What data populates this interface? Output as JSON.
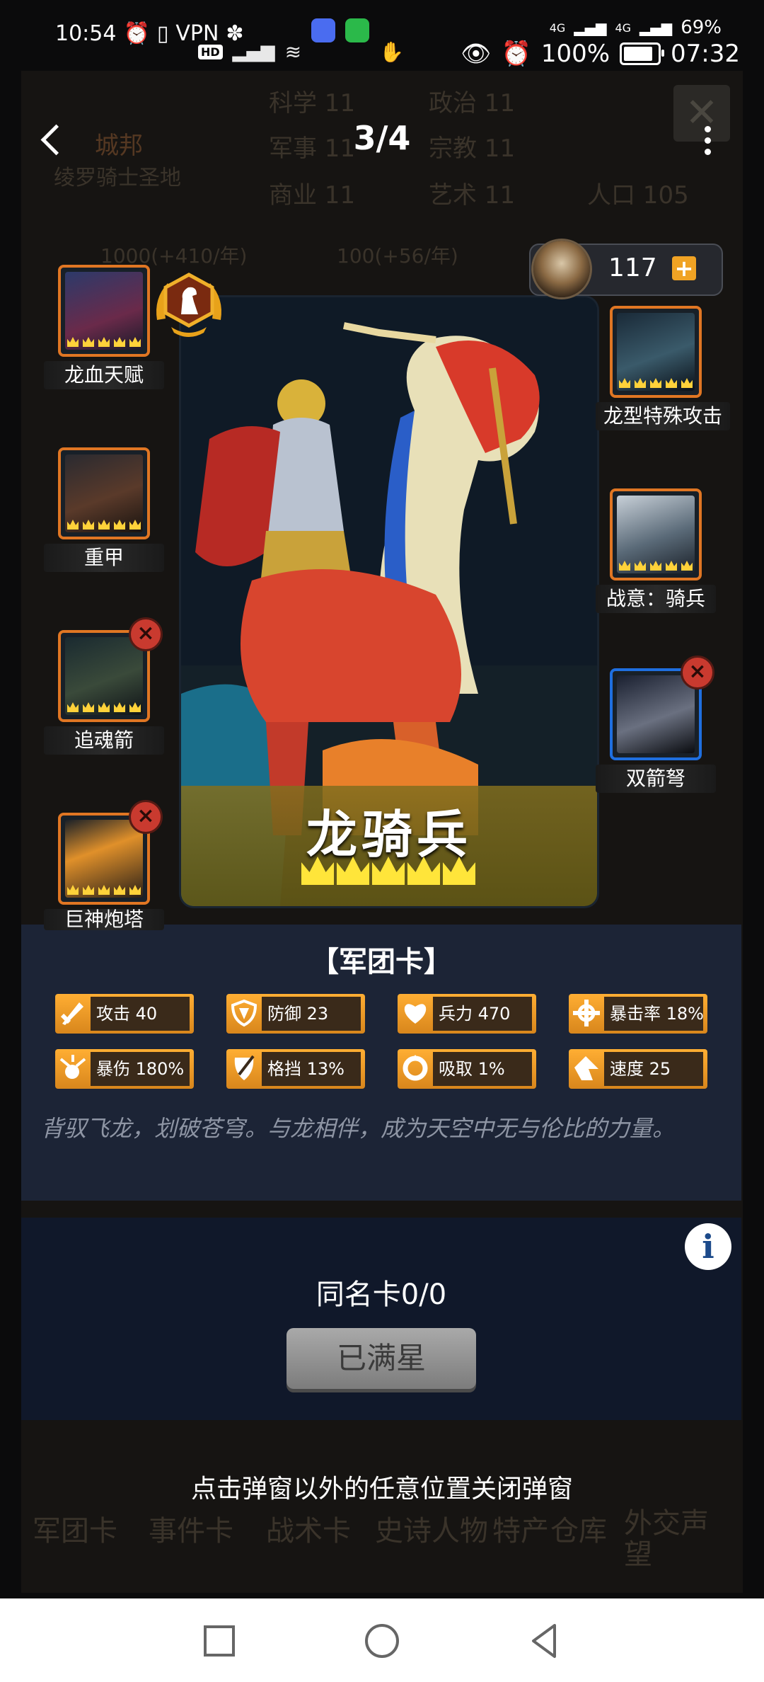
{
  "status_bar": {
    "time_left": "10:54",
    "vpn": "VPN",
    "hd": "HD",
    "net_4g_1": "4G",
    "net_4g_2": "4G",
    "battery_pct_1": "69%",
    "battery_pct_2": "100%",
    "time_right": "07:32"
  },
  "background": {
    "city_badge": "城邦",
    "city_name": "绫罗骑士圣地",
    "stats": [
      "科学 11",
      "政治 11",
      "军事 11",
      "宗教 11",
      "商业 11",
      "艺术 11",
      "人口 105"
    ],
    "resource_1": "1000(+410/年)",
    "resource_2": "100(+56/年)",
    "tabs": [
      "军团卡",
      "事件卡",
      "战术卡",
      "史诗人物",
      "特产",
      "仓库",
      "外交声望"
    ]
  },
  "header": {
    "page_counter": "3/4"
  },
  "currency": {
    "value": "117",
    "plus": "+"
  },
  "skills_left": [
    {
      "label": "龙血天赋",
      "removable": false
    },
    {
      "label": "重甲",
      "removable": false
    },
    {
      "label": "追魂箭",
      "removable": true
    },
    {
      "label": "巨神炮塔",
      "removable": true
    }
  ],
  "skills_right": [
    {
      "label": "龙型特殊攻击",
      "removable": false
    },
    {
      "label": "战意：骑兵",
      "removable": false
    },
    {
      "label": "双箭弩",
      "removable": true
    }
  ],
  "card": {
    "name": "龙骑兵",
    "stars": 5,
    "type": "【军团卡】"
  },
  "stats": [
    {
      "icon": "sword-icon",
      "label": "攻击 40"
    },
    {
      "icon": "shield-icon",
      "label": "防御 23"
    },
    {
      "icon": "heart-icon",
      "label": "兵力 470"
    },
    {
      "icon": "crit-rate-icon",
      "label": "暴击率 18%"
    },
    {
      "icon": "crit-damage-icon",
      "label": "暴伤 180%"
    },
    {
      "icon": "block-icon",
      "label": "格挡 13%"
    },
    {
      "icon": "lifesteal-icon",
      "label": "吸取 1%"
    },
    {
      "icon": "speed-icon",
      "label": "速度 25"
    }
  ],
  "description": "背驭飞龙，划破苍穹。与龙相伴，成为天空中无与伦比的力量。",
  "duplicate": {
    "count_label": "同名卡0/0",
    "button_label": "已满星"
  },
  "hint": "点击弹窗以外的任意位置关闭弹窗",
  "colors": {
    "accent_orange": "#e07623",
    "stat_gold": "#ffae33",
    "panel": "#1c2436",
    "crown": "#ffe53a"
  }
}
